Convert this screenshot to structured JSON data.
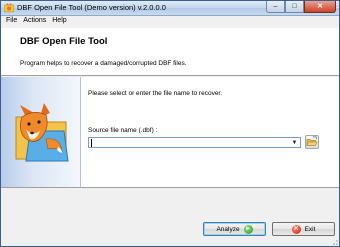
{
  "window": {
    "title": "DBF Open File Tool (Demo version) v.2.0.0.0",
    "minimize_symbol": "–",
    "maximize_symbol": "□",
    "close_symbol": "✕"
  },
  "menu": {
    "items": [
      {
        "label": "File"
      },
      {
        "label": "Actions"
      },
      {
        "label": "Help"
      }
    ]
  },
  "header": {
    "title": "DBF Open File Tool",
    "description": "Program helps to recover a damaged/corrupted DBF files."
  },
  "main": {
    "instruction": "Please select or enter the file name to recover.",
    "source_label": "Source file name (.dbf) :",
    "source_value": "",
    "dropdown_arrow": "▼"
  },
  "buttons": {
    "analyze_label": "Analyze",
    "analyze_icon": "►",
    "exit_label": "Exit",
    "exit_icon": "✕"
  },
  "icons": {
    "app": "fox-app-icon",
    "logo": "fox-folder-logo",
    "browse": "open-folder-icon"
  },
  "colors": {
    "left_panel": "#b7ccea",
    "title_gradient_top": "#dfeaf6",
    "close_button": "#c9432a",
    "analyze_icon": "#1f9a1f",
    "exit_icon": "#c81c0c"
  }
}
